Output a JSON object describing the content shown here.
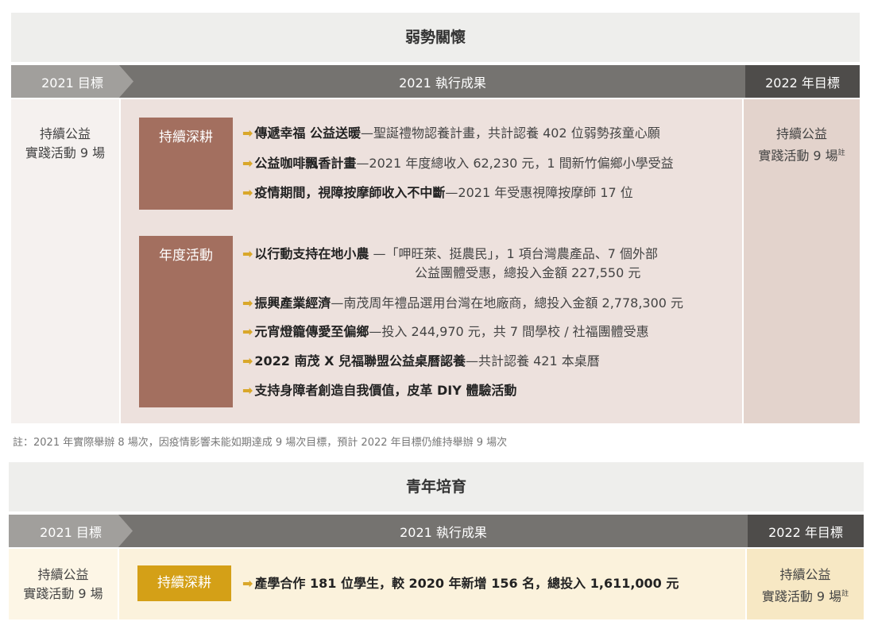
{
  "section1": {
    "title": "弱勢關懷",
    "header": {
      "left": "2021 目標",
      "mid": "2021 執行成果",
      "right": "2022 年目標"
    },
    "left_goal": {
      "line1": "持續公益",
      "line2": "實踐活動 9 場"
    },
    "right_goal": {
      "line1": "持續公益",
      "line2": "實踐活動 9 場",
      "sup": "註"
    },
    "group1": {
      "tag": "持續深耕",
      "items": [
        {
          "bold": "傳遞幸福 公益送暖",
          "text": "—聖誕禮物認養計畫，共計認養 402 位弱勢孩童心願"
        },
        {
          "bold": "公益咖啡飄香計畫",
          "text": "—2021 年度總收入 62,230 元，1 間新竹偏鄉小學受益"
        },
        {
          "bold": "疫情期間，視障按摩師收入不中斷",
          "text": "—2021 年受惠視障按摩師 17 位"
        }
      ]
    },
    "group2": {
      "tag": "年度活動",
      "items": [
        {
          "bold": "以行動支持在地小農",
          "text": " —「呷旺萊、挺農民」，1 項台灣農產品、7 個外部",
          "text2": "公益團體受惠，總投入金額 227,550 元"
        },
        {
          "bold": "振興產業經濟",
          "text": "—南茂周年禮品選用台灣在地廠商，總投入金額 2,778,300 元"
        },
        {
          "bold": "元宵燈籠傳愛至偏鄉",
          "text": "—投入 244,970 元，共 7 間學校 / 社福團體受惠"
        },
        {
          "bold": "2022 南茂 X 兒福聯盟公益桌曆認養",
          "text": "—共計認養 421 本桌曆"
        },
        {
          "bold": "支持身障者創造自我價值，皮革 DIY 體驗活動",
          "text": ""
        }
      ]
    },
    "note": "註：2021 年實際舉辦 8 場次，因疫情影響未能如期達成 9 場次目標，預計 2022 年目標仍維持舉辦 9 場次"
  },
  "section2": {
    "title": "青年培育",
    "header": {
      "left": "2021 目標",
      "mid": "2021 執行成果",
      "right": "2022 年目標"
    },
    "left_goal": {
      "line1": "持續公益",
      "line2": "實踐活動 9 場"
    },
    "right_goal": {
      "line1": "持續公益",
      "line2": "實踐活動 9 場",
      "sup": "註"
    },
    "tag": "持續深耕",
    "item": {
      "bold": "產學合作 181 位學生，較 2020 年新增 156 名，總投入 1,611,000 元",
      "text": ""
    }
  },
  "colors": {
    "tag_brown": "#a36f5f",
    "tag_gold": "#d4a017",
    "panel_beige": "#ede1dd",
    "panel_cream": "#fbf2dc",
    "arrow": "#d9a72a"
  }
}
